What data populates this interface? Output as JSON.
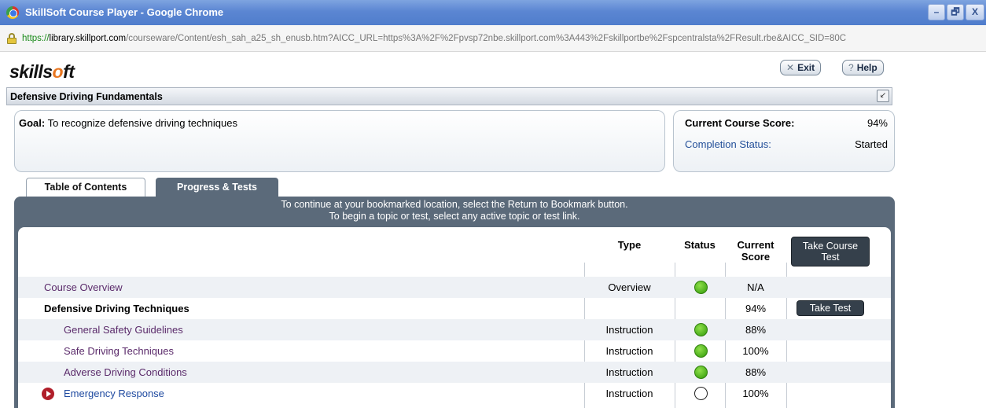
{
  "window": {
    "title": "SkillSoft Course Player - Google Chrome",
    "min_label": "–",
    "max_label": "🗗",
    "close_label": "X"
  },
  "address": {
    "scheme": "https://",
    "host": "library.skillport.com",
    "path": "/courseware/Content/esh_sah_a25_sh_enusb.htm?AICC_URL=https%3A%2F%2Fpvsp72nbe.skillport.com%3A443%2Fskillportbe%2Fspcentralsta%2FResult.rbe&AICC_SID=80C"
  },
  "header": {
    "logo_part1": "skills",
    "logo_o": "o",
    "logo_part2": "ft",
    "exit_glyph": "✕",
    "exit_label": "Exit",
    "help_glyph": "?",
    "help_label": "Help"
  },
  "course": {
    "title": "Defensive Driving Fundamentals",
    "popout_glyph": "↙"
  },
  "goal": {
    "label": "Goal:",
    "text": " To recognize defensive driving techniques"
  },
  "score": {
    "current_label": "Current Course Score:",
    "current_value": "94%",
    "completion_label": "Completion Status:",
    "completion_value": "Started"
  },
  "tabs": {
    "toc": "Table of Contents",
    "progress": "Progress & Tests"
  },
  "instructions": {
    "line1": "To continue at your bookmarked location, select the Return to Bookmark button.",
    "line2": "To begin a topic or test, select any active topic or test link."
  },
  "columns": {
    "type": "Type",
    "status": "Status",
    "score_line1": "Current",
    "score_line2": "Score",
    "take_course_line1": "Take Course",
    "take_course_line2": "Test"
  },
  "rows": [
    {
      "topic": "Course Overview",
      "type": "Overview",
      "status": "complete",
      "score": "N/A"
    },
    {
      "topic": "Defensive Driving Techniques",
      "type": "",
      "status": "",
      "score": "94%",
      "button": "Take Test"
    },
    {
      "topic": "General Safety Guidelines",
      "type": "Instruction",
      "status": "complete",
      "score": "88%"
    },
    {
      "topic": "Safe Driving Techniques",
      "type": "Instruction",
      "status": "complete",
      "score": "100%"
    },
    {
      "topic": "Adverse Driving Conditions",
      "type": "Instruction",
      "status": "complete",
      "score": "88%"
    },
    {
      "topic": "Emergency Response",
      "type": "Instruction",
      "status": "not-started",
      "score": "100%"
    }
  ]
}
